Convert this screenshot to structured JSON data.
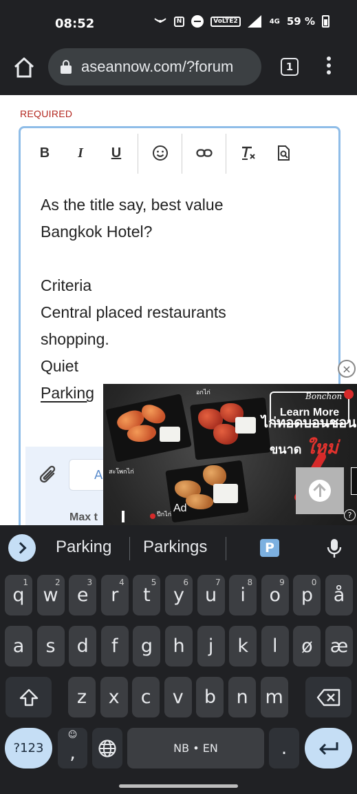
{
  "status_bar": {
    "time": "08:52",
    "battery_percent": "59 %",
    "icons": [
      "hotspot-icon",
      "nfc-icon",
      "do-not-disturb-icon",
      "volte-icon",
      "signal-icon",
      "4g-icon",
      "battery-icon"
    ],
    "volte_label": "VoLTE2",
    "net_label": "4G"
  },
  "browser": {
    "url": "aseannow.com/?forum",
    "tab_count": "1"
  },
  "form": {
    "required_label": "REQUIRED",
    "toolbar": {
      "bold": "B",
      "italic": "I",
      "underline": "U"
    },
    "body_lines": [
      "As the title say, best value",
      "Bangkok Hotel?",
      "",
      "Criteria",
      "Central placed restaurants",
      "shopping.",
      "Quiet",
      "Parking"
    ],
    "attach_placeholder": "A",
    "max_text": "Max t",
    "close_ad": "×"
  },
  "ad": {
    "learn_more": "Learn More",
    "brand": "Bonchon",
    "headline_1": "ไก่ทอดบอนชอน",
    "headline_2_prefix": "ขนาด",
    "headline_2_accent": "ใหม่",
    "small_label_top": "อกไก่",
    "small_label_left": "สะโพกไก่",
    "small_label_bottom": "ปีกไก่",
    "ad_label": "Ad",
    "info": "?",
    "accent_color": "#e2322d"
  },
  "keyboard": {
    "suggestions": [
      "Parking",
      "Parkings"
    ],
    "row1": [
      {
        "k": "q",
        "h": "1"
      },
      {
        "k": "w",
        "h": "2"
      },
      {
        "k": "e",
        "h": "3"
      },
      {
        "k": "r",
        "h": "4"
      },
      {
        "k": "t",
        "h": "5"
      },
      {
        "k": "y",
        "h": "6"
      },
      {
        "k": "u",
        "h": "7"
      },
      {
        "k": "i",
        "h": "8"
      },
      {
        "k": "o",
        "h": "9"
      },
      {
        "k": "p",
        "h": "0"
      },
      {
        "k": "å",
        "h": ""
      }
    ],
    "row2": [
      "a",
      "s",
      "d",
      "f",
      "g",
      "h",
      "j",
      "k",
      "l",
      "ø",
      "æ"
    ],
    "row3": [
      "z",
      "x",
      "c",
      "v",
      "b",
      "n",
      "m"
    ],
    "sym_label": "?123",
    "comma": ",",
    "space_label": "NB • EN",
    "period": ".",
    "accent": "#c5def5"
  }
}
